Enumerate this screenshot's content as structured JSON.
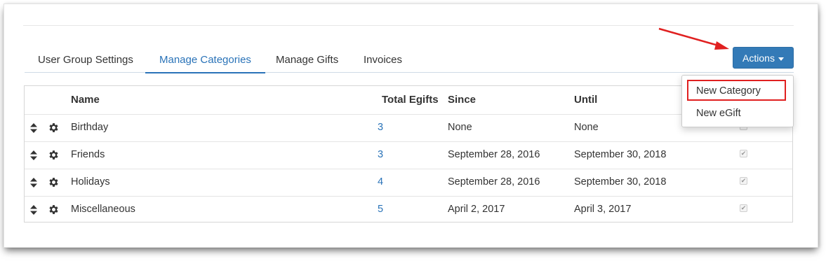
{
  "tabs": [
    {
      "label": "User Group Settings",
      "active": false
    },
    {
      "label": "Manage Categories",
      "active": true
    },
    {
      "label": "Manage Gifts",
      "active": false
    },
    {
      "label": "Invoices",
      "active": false
    }
  ],
  "actions": {
    "label": "Actions",
    "caret_icon": "caret-down-icon"
  },
  "dropdown": {
    "items": [
      "New Category",
      "New eGift"
    ]
  },
  "table": {
    "headers": {
      "name": "Name",
      "total_egifts": "Total Egifts",
      "since": "Since",
      "until": "Until"
    },
    "rows": [
      {
        "name": "Birthday",
        "total": "3",
        "since": "None",
        "until": "None",
        "checked": false
      },
      {
        "name": "Friends",
        "total": "3",
        "since": "September 28, 2016",
        "until": "September 30, 2018",
        "checked": true
      },
      {
        "name": "Holidays",
        "total": "4",
        "since": "September 28, 2016",
        "until": "September 30, 2018",
        "checked": true
      },
      {
        "name": "Miscellaneous",
        "total": "5",
        "since": "April 2, 2017",
        "until": "April 3, 2017",
        "checked": true
      }
    ]
  },
  "colors": {
    "accent": "#337ab7",
    "link": "#2a73b8",
    "annotation": "#e02020"
  },
  "icons": {
    "row_drag": "sort-icon",
    "row_settings": "gear-icon",
    "annotation": "red-arrow"
  }
}
